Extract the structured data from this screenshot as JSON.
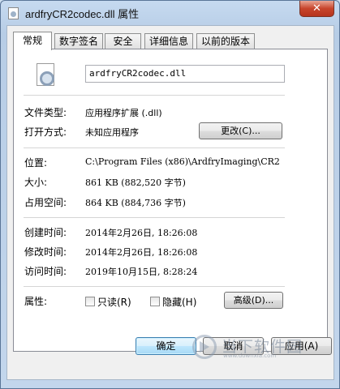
{
  "window": {
    "title": "ardfryCR2codec.dll 属性",
    "close_glyph": "✕"
  },
  "tabs": [
    {
      "label": "常规"
    },
    {
      "label": "数字签名"
    },
    {
      "label": "安全"
    },
    {
      "label": "详细信息"
    },
    {
      "label": "以前的版本"
    }
  ],
  "general": {
    "file_name": "ardfryCR2codec.dll",
    "file_type_label": "文件类型:",
    "file_type_value": "应用程序扩展 (.dll)",
    "open_with_label": "打开方式:",
    "open_with_value": "未知应用程序",
    "change_button": "更改(C)...",
    "location_label": "位置:",
    "location_value": "C:\\Program Files (x86)\\ArdfryImaging\\CR2",
    "size_label": "大小:",
    "size_value": "861 KB (882,520 字节)",
    "size_on_disk_label": "占用空间:",
    "size_on_disk_value": "864 KB (884,736 字节)",
    "created_label": "创建时间:",
    "created_value": "2014年2月26日, 18:26:08",
    "modified_label": "修改时间:",
    "modified_value": "2014年2月26日, 18:26:08",
    "accessed_label": "访问时间:",
    "accessed_value": "2019年10月15日, 8:28:24",
    "attributes_label": "属性:",
    "readonly_label": "只读(R)",
    "hidden_label": "隐藏(H)",
    "advanced_button": "高级(D)..."
  },
  "footer": {
    "ok": "确定",
    "cancel": "取消",
    "apply": "应用(A)"
  },
  "watermark": {
    "text": "当下软件园",
    "sub": "www.downxia.com"
  }
}
